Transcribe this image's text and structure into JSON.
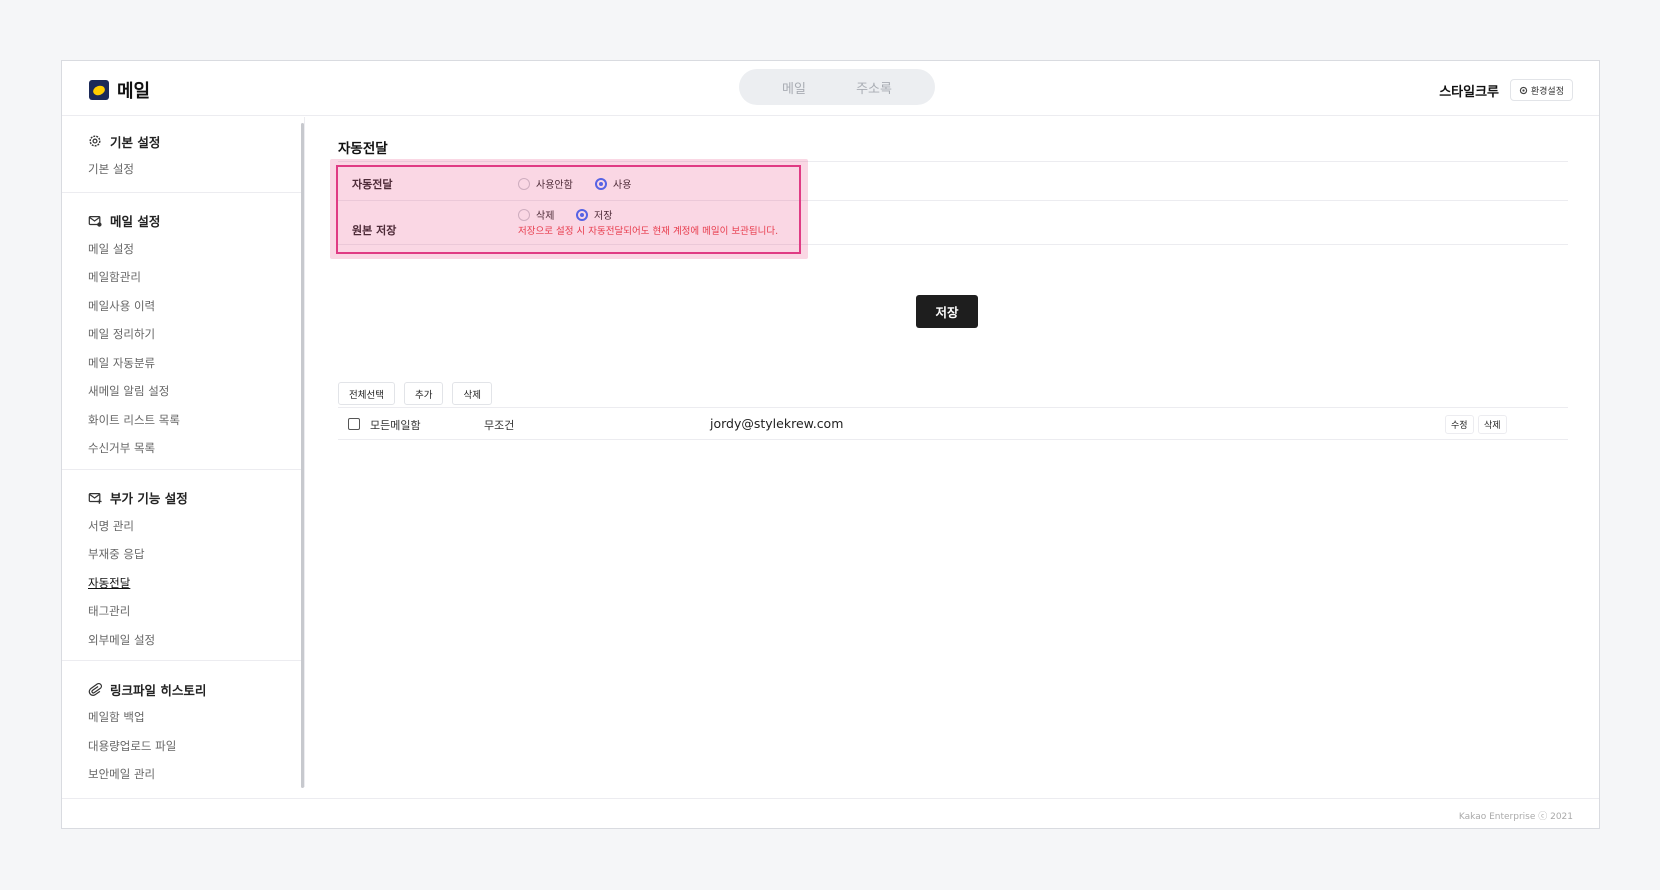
{
  "app": {
    "title": "메일"
  },
  "gnb": {
    "tabs": [
      {
        "label": "메일"
      },
      {
        "label": "주소록"
      }
    ]
  },
  "header": {
    "user_name": "스타일크루",
    "settings_label": "환경설정"
  },
  "sidebar": {
    "groups": [
      {
        "title": "기본 설정",
        "icon": "gear-icon",
        "items": [
          {
            "label": "기본 설정"
          }
        ]
      },
      {
        "title": "메일 설정",
        "icon": "mail-settings-icon",
        "items": [
          {
            "label": "메일 설정"
          },
          {
            "label": "메일함관리"
          },
          {
            "label": "메일사용 이력"
          },
          {
            "label": "메일 정리하기"
          },
          {
            "label": "메일 자동분류"
          },
          {
            "label": "새메일 알림 설정"
          },
          {
            "label": "화이트 리스트 목록"
          },
          {
            "label": "수신거부 목록"
          }
        ]
      },
      {
        "title": "부가 기능 설정",
        "icon": "mail-plus-icon",
        "items": [
          {
            "label": "서명 관리"
          },
          {
            "label": "부재중 응답"
          },
          {
            "label": "자동전달"
          },
          {
            "label": "태그관리"
          },
          {
            "label": "외부메일 설정"
          }
        ]
      },
      {
        "title": "링크파일 히스토리",
        "icon": "paperclip-icon",
        "items": [
          {
            "label": "메일함 백업"
          },
          {
            "label": "대용량업로드 파일"
          },
          {
            "label": "보안메일 관리"
          }
        ]
      }
    ],
    "active_item": "자동전달"
  },
  "main": {
    "title": "자동전달",
    "forwarding": {
      "label": "자동전달",
      "options": [
        {
          "label": "사용안함",
          "selected": false
        },
        {
          "label": "사용",
          "selected": true
        }
      ]
    },
    "keep_original": {
      "label": "원본 저장",
      "options": [
        {
          "label": "삭제",
          "selected": false
        },
        {
          "label": "저장",
          "selected": true
        }
      ],
      "notice": "저장으로 설정 시 자동전달되어도 현재 계정에 메일이 보관됩니다."
    },
    "save_label": "저장",
    "toolbar": {
      "select_all": "전체선택",
      "add": "추가",
      "delete": "삭제"
    },
    "rules": [
      {
        "mailbox": "모든메일함",
        "condition": "무조건",
        "email": "jordy@stylekrew.com",
        "edit_label": "수정",
        "delete_label": "삭제"
      }
    ]
  },
  "footer": {
    "copyright": "Kakao Enterprise ⓒ 2021"
  },
  "colors": {
    "accent": "#2f6bff",
    "highlight": "#e03b84",
    "warning": "#e8383d",
    "primary_button": "#1e1e1e"
  }
}
